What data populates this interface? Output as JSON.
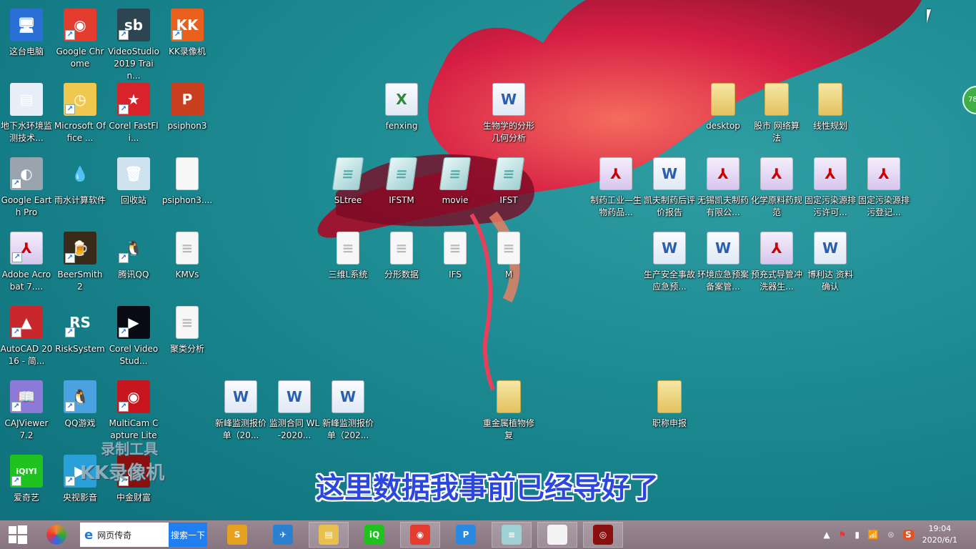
{
  "desktop": {
    "icons": [
      {
        "label": "这台电脑",
        "type": "app",
        "color": "#2a6fd6",
        "glyph": "🖥"
      },
      {
        "label": "地下水环境监测技术...",
        "type": "app",
        "color": "#e8eef8",
        "glyph": "▤"
      },
      {
        "label": "Google Earth Pro",
        "type": "app",
        "color": "#9aa4ae",
        "glyph": "◐",
        "shortcut": true
      },
      {
        "label": "Adobe Acrobat 7....",
        "type": "pdf",
        "glyph": "⅄",
        "shortcut": true
      },
      {
        "label": "AutoCAD 2016 - 简...",
        "type": "app",
        "color": "#c8282c",
        "glyph": "▲",
        "shortcut": true
      },
      {
        "label": "CAJViewer 7.2",
        "type": "app",
        "color": "#8c7ad8",
        "glyph": "📖",
        "shortcut": true
      },
      {
        "label": "爱奇艺",
        "type": "app",
        "color": "#1fc21f",
        "glyph": "iQIYI",
        "shortcut": true
      },
      {
        "label": "Google Chrome",
        "type": "app",
        "color": "#e33b2e",
        "glyph": "◉",
        "shortcut": true
      },
      {
        "label": "Microsoft Office ...",
        "type": "app",
        "color": "#f0c850",
        "glyph": "◷",
        "shortcut": true
      },
      {
        "label": "雨水计算软件",
        "type": "app",
        "color": "transparent",
        "glyph": "💧"
      },
      {
        "label": "BeerSmith 2",
        "type": "app",
        "color": "#3a2a1a",
        "glyph": "🍺",
        "shortcut": true
      },
      {
        "label": "RiskSystem",
        "type": "app",
        "color": "transparent",
        "glyph": "RS",
        "shortcut": true
      },
      {
        "label": "QQ游戏",
        "type": "app",
        "color": "#4aa3e0",
        "glyph": "🐧",
        "shortcut": true
      },
      {
        "label": "央视影音",
        "type": "app",
        "color": "#2aa0d8",
        "glyph": "▶",
        "shortcut": true
      },
      {
        "label": "VideoStudio 2019 Train...",
        "type": "app",
        "color": "#2d4550",
        "glyph": "sb",
        "shortcut": true
      },
      {
        "label": "Corel FastFli...",
        "type": "app",
        "color": "#d8232a",
        "glyph": "★",
        "shortcut": true
      },
      {
        "label": "回收站",
        "type": "app",
        "color": "#cfe3ee",
        "glyph": "🗑"
      },
      {
        "label": "腾讯QQ",
        "type": "app",
        "color": "transparent",
        "glyph": "🐧",
        "shortcut": true
      },
      {
        "label": "Corel VideoStud...",
        "type": "app",
        "color": "#0a0a14",
        "glyph": "▶",
        "shortcut": true
      },
      {
        "label": "MultiCam Capture Lite",
        "type": "app",
        "color": "#c8161e",
        "glyph": "◉",
        "shortcut": true
      },
      {
        "label": "中金财富",
        "type": "app",
        "color": "#8a1010",
        "glyph": "◎",
        "shortcut": true
      },
      {
        "label": "KK录像机",
        "type": "app",
        "color": "#e8601c",
        "glyph": "KK",
        "shortcut": true
      },
      {
        "label": "psiphon3",
        "type": "app",
        "color": "#c84020",
        "glyph": "P"
      },
      {
        "label": "psiphon3....",
        "type": "text",
        "glyph": ""
      },
      {
        "label": "KMVs",
        "type": "text",
        "glyph": "≡"
      },
      {
        "label": "聚类分析",
        "type": "text",
        "glyph": "≡"
      },
      {
        "label": "fenxing",
        "type": "excel",
        "glyph": "X"
      },
      {
        "label": "生物学的分形几何分析",
        "type": "word",
        "glyph": "W"
      },
      {
        "label": "SLtree",
        "type": "note",
        "glyph": "≡"
      },
      {
        "label": "IFSTM",
        "type": "note",
        "glyph": "≡"
      },
      {
        "label": "movie",
        "type": "note",
        "glyph": "≡"
      },
      {
        "label": "IFST",
        "type": "note",
        "glyph": "≡"
      },
      {
        "label": "三维L系统",
        "type": "text",
        "glyph": "≡"
      },
      {
        "label": "分形数据",
        "type": "text",
        "glyph": "≡"
      },
      {
        "label": "IFS",
        "type": "text",
        "glyph": "≡"
      },
      {
        "label": "M",
        "type": "text",
        "glyph": "≡"
      },
      {
        "label": "新峰监测报价单（20...",
        "type": "word",
        "glyph": "W"
      },
      {
        "label": "监测合同 WL-2020...",
        "type": "word",
        "glyph": "W"
      },
      {
        "label": "新峰监测报价单（202...",
        "type": "word",
        "glyph": "W"
      },
      {
        "label": "重金属植物修复",
        "type": "folder",
        "glyph": ""
      },
      {
        "label": "职称申报",
        "type": "folder",
        "glyph": ""
      },
      {
        "label": "desktop",
        "type": "folder",
        "glyph": ""
      },
      {
        "label": "股市 网络算法",
        "type": "folder",
        "glyph": ""
      },
      {
        "label": "线性规划",
        "type": "folder",
        "glyph": ""
      },
      {
        "label": "制药工业—生物药品...",
        "type": "pdf",
        "glyph": "⅄"
      },
      {
        "label": "凯夫制药后评价报告",
        "type": "word",
        "glyph": "W"
      },
      {
        "label": "无锡凯夫制药有限公...",
        "type": "pdf",
        "glyph": "⅄"
      },
      {
        "label": "化学原料药规范",
        "type": "pdf",
        "glyph": "⅄"
      },
      {
        "label": "固定污染源排污许可...",
        "type": "pdf",
        "glyph": "⅄"
      },
      {
        "label": "固定污染源排污登记...",
        "type": "pdf",
        "glyph": "⅄"
      },
      {
        "label": "生产安全事故应急预...",
        "type": "word",
        "glyph": "W"
      },
      {
        "label": "环境应急预案备案管...",
        "type": "word",
        "glyph": "W"
      },
      {
        "label": "预充式导管冲洗器生...",
        "type": "pdf",
        "glyph": "⅄"
      },
      {
        "label": "博利达 资料确认",
        "type": "word",
        "glyph": "W"
      }
    ]
  },
  "overlay": {
    "subtitle": "这里数据我事前已经导好了",
    "watermark_line1": "录制工具",
    "watermark_line2": "KK录像机",
    "badge": "78"
  },
  "taskbar": {
    "start_icon": "windows-logo-icon",
    "search_value": "网页传奇",
    "search_button": "搜索一下",
    "apps": [
      {
        "name": "360-browser",
        "color": "#e8a020",
        "glyph": "S",
        "open": false
      },
      {
        "name": "feishu",
        "color": "#2a7fd0",
        "glyph": "✈",
        "open": false
      },
      {
        "name": "file-explorer",
        "color": "#e8c050",
        "glyph": "▤",
        "open": true
      },
      {
        "name": "iqiyi",
        "color": "#1fc21f",
        "glyph": "iQ",
        "open": false
      },
      {
        "name": "chrome",
        "color": "#e33b2e",
        "glyph": "◉",
        "open": true
      },
      {
        "name": "pp-assistant",
        "color": "#2a8ae0",
        "glyph": "P",
        "open": false
      },
      {
        "name": "notepad",
        "color": "#9fd0d2",
        "glyph": "≡",
        "open": true
      },
      {
        "name": "text-file",
        "color": "#f4f4f4",
        "glyph": "",
        "open": true
      },
      {
        "name": "zhongjin-caifu",
        "color": "#8a1010",
        "glyph": "◎",
        "open": true
      }
    ],
    "clock_time": "19:04",
    "clock_date": "2020/6/1"
  }
}
